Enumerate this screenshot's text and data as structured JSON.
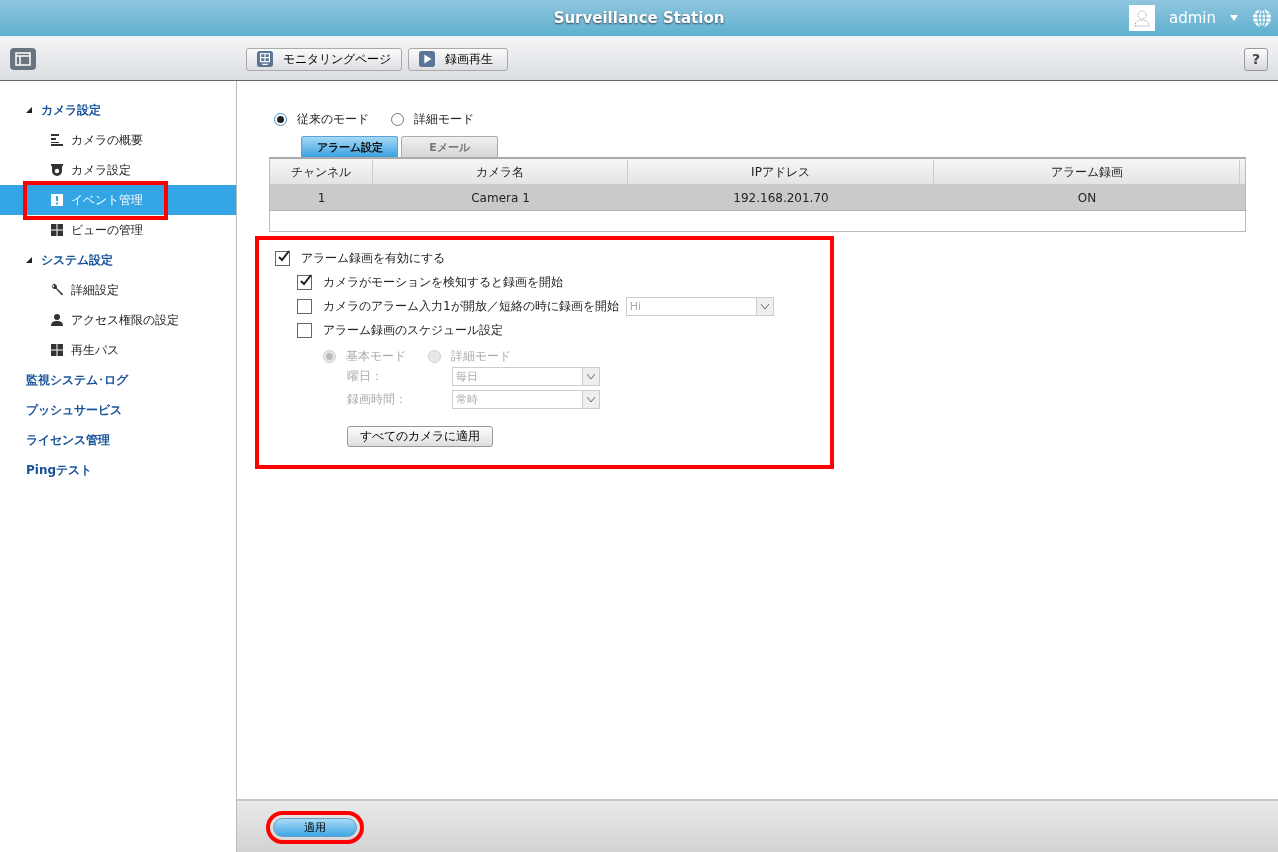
{
  "header": {
    "title": "Surveillance Station",
    "user": "admin"
  },
  "toolbar": {
    "buttons": [
      {
        "label": "モニタリングページ",
        "kind": "monitor"
      },
      {
        "label": "録画再生",
        "kind": "play"
      }
    ],
    "help": "?"
  },
  "sidebar": {
    "items": [
      {
        "label": "カメラ設定",
        "expanded": true,
        "children": [
          {
            "label": "カメラの概要",
            "kind": "list",
            "selected": false,
            "highlighted": false
          },
          {
            "label": "カメラ設定",
            "kind": "camera",
            "selected": false,
            "highlighted": false
          },
          {
            "label": "イベント管理",
            "kind": "alert",
            "selected": true,
            "highlighted": true
          },
          {
            "label": "ビューの管理",
            "kind": "grid",
            "selected": false,
            "highlighted": false
          }
        ]
      },
      {
        "label": "システム設定",
        "expanded": true,
        "children": [
          {
            "label": "詳細設定",
            "kind": "wrench",
            "selected": false,
            "highlighted": false
          },
          {
            "label": "アクセス権限の設定",
            "kind": "person",
            "selected": false,
            "highlighted": false
          },
          {
            "label": "再生パス",
            "kind": "grid",
            "selected": false,
            "highlighted": false
          }
        ]
      },
      {
        "label": "監視システム･ログ"
      },
      {
        "label": "プッシュサービス"
      },
      {
        "label": "ライセンス管理"
      },
      {
        "label": "Pingテスト"
      }
    ]
  },
  "modes": [
    {
      "label": "従来のモード",
      "selected": true
    },
    {
      "label": "詳細モード",
      "selected": false
    }
  ],
  "tabs": [
    {
      "label": "アラーム設定",
      "selected": true
    },
    {
      "label": "Eメール",
      "selected": false
    }
  ],
  "table": {
    "columns": [
      "チャンネル",
      "カメラ名",
      "IPアドレス",
      "アラーム録画"
    ],
    "rows": [
      {
        "cells": [
          "1",
          "Camera 1",
          "192.168.201.70",
          "ON"
        ],
        "selected": true
      }
    ]
  },
  "alarm": {
    "highlighted": true,
    "enable": {
      "label": "アラーム録画を有効にする",
      "checked": true
    },
    "options": [
      {
        "label": "カメラがモーションを検知すると録画を開始",
        "checked": true
      },
      {
        "label": "カメラのアラーム入力1が開放／短絡の時に録画を開始",
        "checked": false,
        "select": "Hi"
      },
      {
        "label": "アラーム録画のスケジュール設定",
        "checked": false
      }
    ],
    "schedule": {
      "disabled": true,
      "modes": [
        {
          "label": "基本モード",
          "selected": true
        },
        {
          "label": "詳細モード",
          "selected": false
        }
      ],
      "fields": [
        {
          "label": "曜日：",
          "value": "毎日"
        },
        {
          "label": "録画時間：",
          "value": "常時"
        }
      ]
    },
    "apply_all": "すべてのカメラに適用"
  },
  "footer": {
    "apply": {
      "label": "適用",
      "highlighted": true
    }
  }
}
